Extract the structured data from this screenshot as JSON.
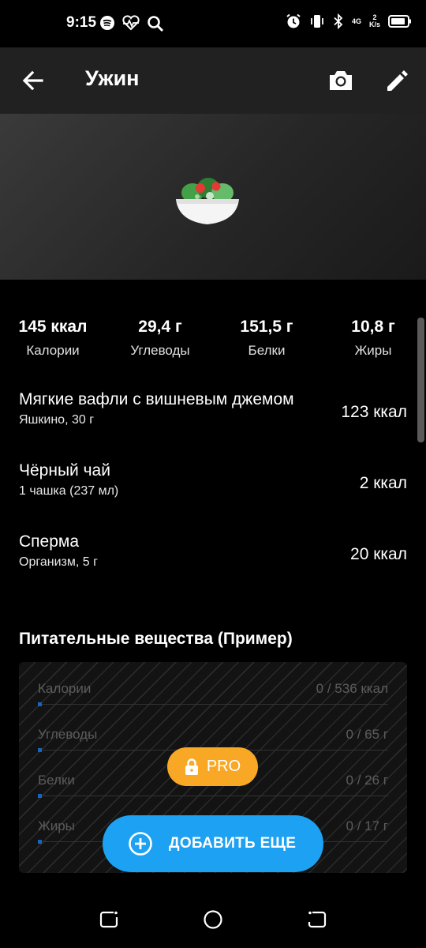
{
  "status_bar": {
    "time": "9:15",
    "network": {
      "line1": "4G",
      "line2": "2",
      "line3": "K/s"
    },
    "left_icons": [
      "spotify-icon",
      "heartbeat-icon",
      "search-icon"
    ],
    "right_icons": [
      "alarm-icon",
      "vibrate-icon",
      "bluetooth-icon",
      "battery-icon"
    ]
  },
  "app_bar": {
    "title": "Ужин",
    "back_icon": "arrow-left-icon",
    "camera_icon": "camera-icon",
    "edit_icon": "pencil-icon"
  },
  "hero": {
    "icon": "salad-bowl-icon"
  },
  "macros": [
    {
      "value": "145 ккал",
      "label": "Калории"
    },
    {
      "value": "29,4 г",
      "label": "Углеводы"
    },
    {
      "value": "151,5 г",
      "label": "Белки"
    },
    {
      "value": "10,8 г",
      "label": "Жиры"
    }
  ],
  "foods": [
    {
      "name": "Мягкие вафли с вишневым джемом",
      "sub": "Яшкино, 30 г",
      "kcal": "123 ккал"
    },
    {
      "name": "Чёрный чай",
      "sub": "1 чашка (237 мл)",
      "kcal": "2 ккал"
    },
    {
      "name": "Сперма",
      "sub": "Организм, 5 г",
      "kcal": "20 ккал"
    }
  ],
  "nutrients": {
    "title": "Питательные вещества (Пример)",
    "rows": [
      {
        "label": "Калории",
        "value": "0 / 536 ккал",
        "progress": 0
      },
      {
        "label": "Углеводы",
        "value": "0 / 65 г",
        "progress": 0
      },
      {
        "label": "Белки",
        "value": "0 / 26 г",
        "progress": 0
      },
      {
        "label": "Жиры",
        "value": "0 / 17 г",
        "progress": 0
      }
    ],
    "pro_label": "PRO",
    "pro_icon": "lock-icon"
  },
  "add_more": {
    "label": "ДОБАВИТЬ ЕЩЕ",
    "icon": "plus-circle-icon"
  },
  "colors": {
    "accent_blue": "#1da1f2",
    "pro_orange": "#f9a825",
    "app_bar": "#212121",
    "background": "#000000"
  },
  "nav_bar": [
    "recent-apps-icon",
    "home-icon",
    "back-nav-icon"
  ]
}
